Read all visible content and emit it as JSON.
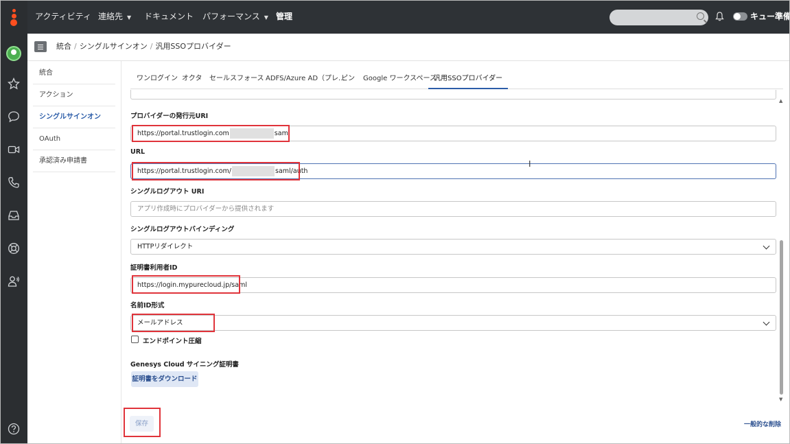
{
  "topbar": {
    "nav": [
      {
        "label": "アクティビティ",
        "caret": false
      },
      {
        "label": "連絡先",
        "caret": true
      },
      {
        "label": "ドキュメント",
        "caret": false
      },
      {
        "label": "パフォーマンス",
        "caret": true
      },
      {
        "label": "管理",
        "caret": false,
        "active": true
      }
    ],
    "queue_label": "キュー準備中"
  },
  "rail": {
    "icons": [
      "avatar",
      "star-icon",
      "chat-icon",
      "video-icon",
      "phone-icon",
      "inbox-icon",
      "lifebuoy-icon",
      "speaker-user-icon",
      "help-icon"
    ]
  },
  "breadcrumb": [
    "統合",
    "シングルサインオン",
    "汎用SSOプロバイダー"
  ],
  "subnav": [
    {
      "label": "統合"
    },
    {
      "label": "アクション"
    },
    {
      "label": "シングルサインオン",
      "active": true
    },
    {
      "label": "OAuth"
    },
    {
      "label": "承認済み申請書"
    }
  ],
  "tabs": [
    "ワンログイン",
    "オクタ",
    "セールスフォース",
    "ADFS/Azure AD（プレ...",
    "ピン",
    "Google ワークスペース",
    "汎用SSOプロバイダー"
  ],
  "form": {
    "issuer_label": "プロバイダーの発行元URI",
    "issuer_prefix": "https://portal.trustlogin.com",
    "issuer_suffix": "saml",
    "url_label": "URL",
    "url_prefix": "https://portal.trustlogin.com/",
    "url_suffix": "saml/auth",
    "slo_uri_label": "シングルログアウト URI",
    "slo_uri_placeholder": "アプリ作成時にプロバイダーから提供されます",
    "slo_binding_label": "シングルログアウトバインディング",
    "slo_binding_value": "HTTPリダイレクト",
    "cert_user_label": "証明書利用者ID",
    "cert_user_value": "https://login.mypurecloud.jp/saml",
    "nameid_label": "名前ID形式",
    "nameid_value": "メールアドレス",
    "endpoint_compress_label": "エンドポイント圧縮",
    "signing_cert_label": "Genesys Cloud サイニング証明書",
    "download_button": "証明書をダウンロード",
    "save_button": "保存",
    "delete_link": "一般的な削除"
  },
  "colors": {
    "topbar": "#2e3236",
    "accent": "#2b5ca8",
    "highlight": "#e0333a",
    "logo": "#ff4f1f"
  }
}
